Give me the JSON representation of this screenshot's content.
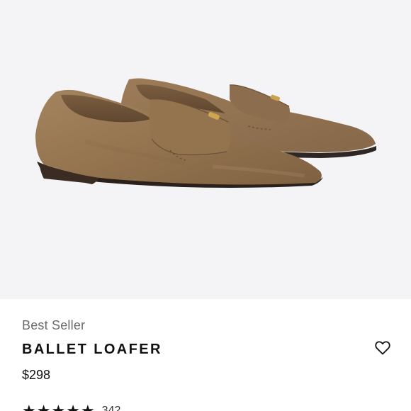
{
  "product": {
    "badge": "Best Seller",
    "title": "BALLET LOAFER",
    "price": "$298",
    "rating": {
      "stars": 5,
      "review_count": "342"
    },
    "image_icon": "loafer-shoe-pair-image",
    "wishlist_icon": "heart-outline-icon"
  },
  "colors": {
    "image_background": "#f4f4f6",
    "suede": "#9a7a58",
    "text_primary": "#111111",
    "text_secondary": "#6b6b6b"
  }
}
